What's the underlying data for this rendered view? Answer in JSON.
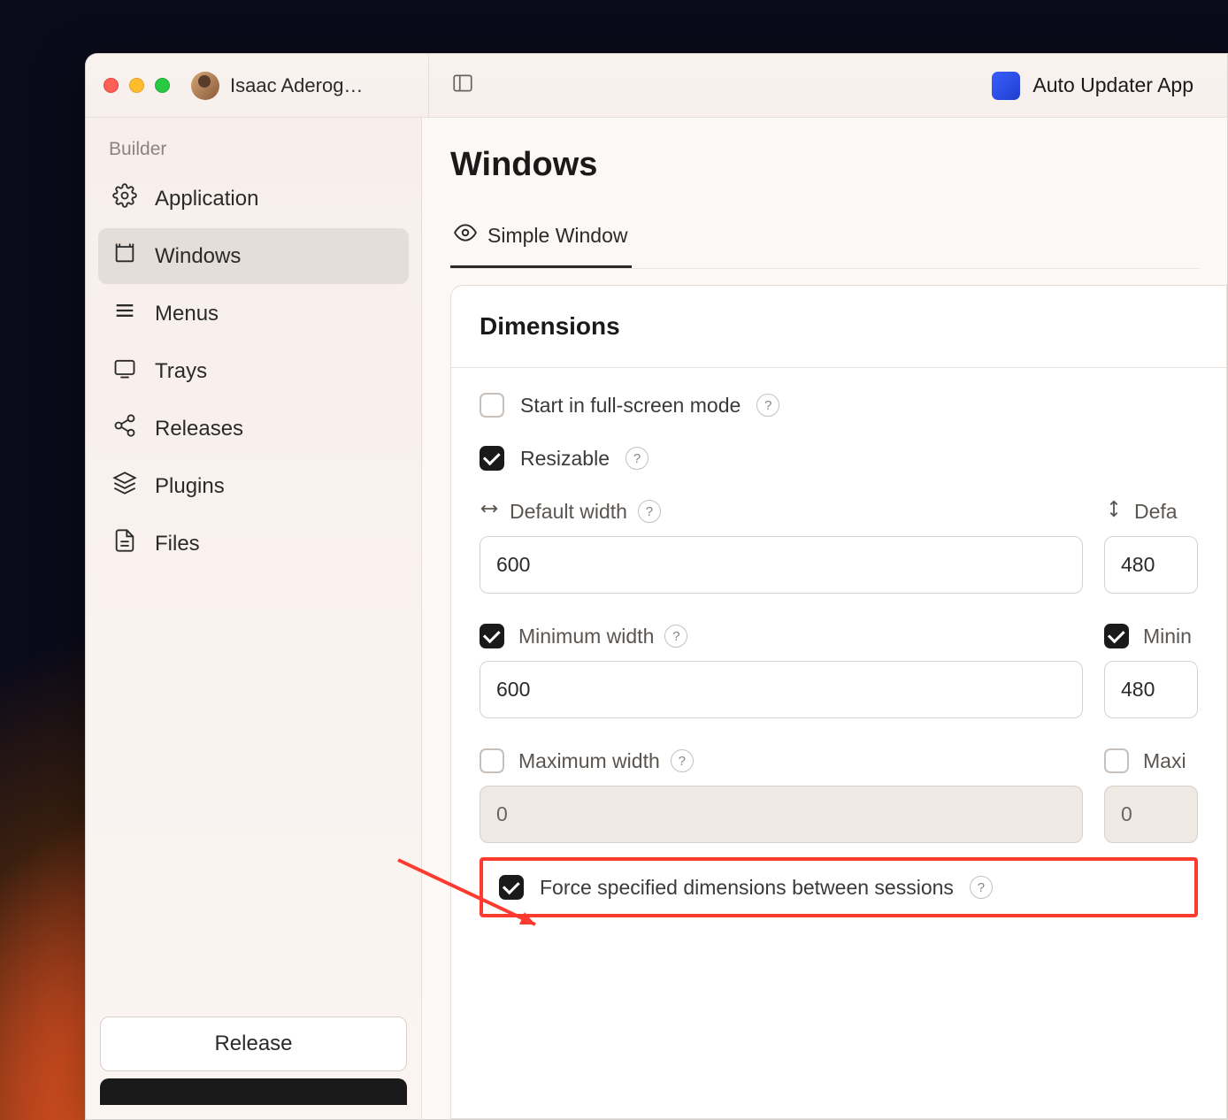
{
  "titlebar": {
    "user_name": "Isaac Aderog…",
    "app_name": "Auto Updater App"
  },
  "sidebar": {
    "section": "Builder",
    "items": [
      {
        "label": "Application"
      },
      {
        "label": "Windows"
      },
      {
        "label": "Menus"
      },
      {
        "label": "Trays"
      },
      {
        "label": "Releases"
      },
      {
        "label": "Plugins"
      },
      {
        "label": "Files"
      }
    ],
    "release_button": "Release"
  },
  "main": {
    "page_title": "Windows",
    "tab_label": "Simple Window",
    "card_title": "Dimensions",
    "fullscreen_label": "Start in full-screen mode",
    "resizable_label": "Resizable",
    "default_width_label": "Default width",
    "default_width_value": "600",
    "default_height_label": "Defa",
    "default_height_value": "480",
    "min_width_label": "Minimum width",
    "min_width_value": "600",
    "min_height_label": "Minin",
    "min_height_value": "480",
    "max_width_label": "Maximum width",
    "max_width_value": "0",
    "max_height_label": "Maxi",
    "max_height_value": "0",
    "force_dims_label": "Force specified dimensions between sessions"
  }
}
